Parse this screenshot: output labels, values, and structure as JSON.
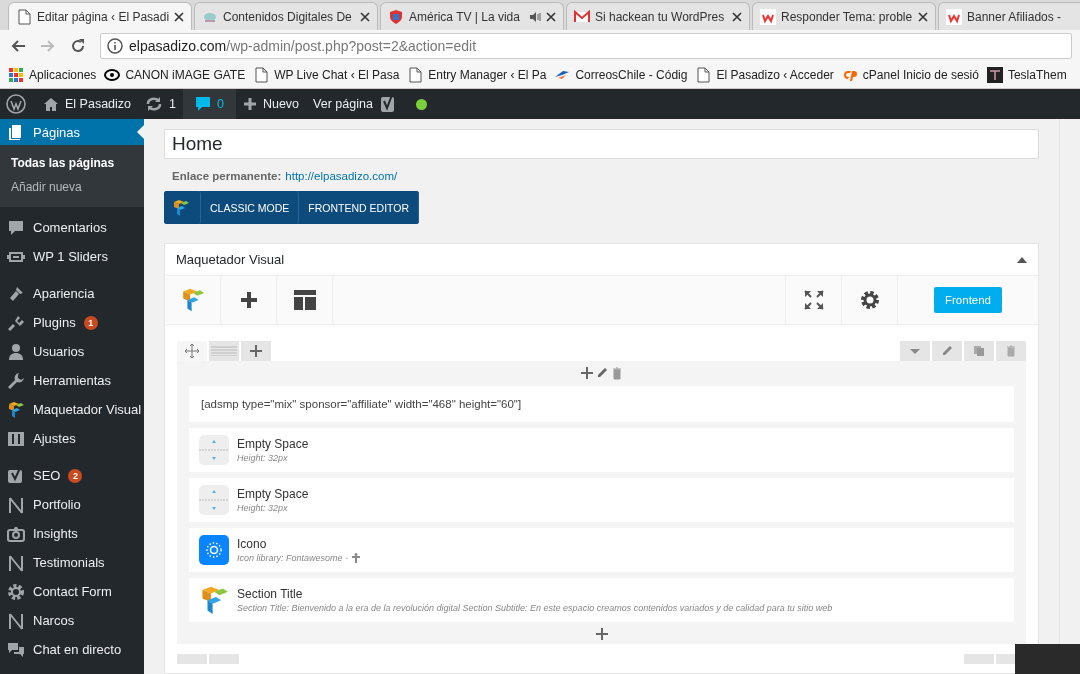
{
  "browser": {
    "tabs": [
      {
        "title": "Editar página ‹ El Pasadi",
        "selected": true
      },
      {
        "title": "Contenidos Digitales De",
        "selected": false
      },
      {
        "title": "América TV | La vida",
        "selected": false
      },
      {
        "title": "Si hackean tu WordPres",
        "selected": false
      },
      {
        "title": "Responder Tema: proble",
        "selected": false
      },
      {
        "title": "Banner Afiliados -",
        "selected": false
      }
    ],
    "url": {
      "host": "elpasadizo.com",
      "path": "/wp-admin/post.php?post=2&action=edit"
    },
    "bookmarks": [
      "Aplicaciones",
      "CANON iMAGE GATE",
      "WP Live Chat ‹ El Pasa",
      "Entry Manager ‹ El Pa",
      "CorreosChile - Códig",
      "El Pasadizo ‹ Acceder",
      "cPanel Inicio de sesió",
      "TeslaThem"
    ]
  },
  "admin_bar": {
    "site": "El Pasadizo",
    "updates": "1",
    "comments": "0",
    "new": "Nuevo",
    "view": "Ver página"
  },
  "sidebar": {
    "groups": [
      [
        {
          "label": "Páginas",
          "selected": true,
          "children": [
            {
              "label": "Todas las páginas",
              "selected": true
            },
            {
              "label": "Añadir nueva",
              "selected": false
            }
          ]
        },
        {
          "label": "Comentarios",
          "selected": false
        },
        {
          "label": "WP 1 Sliders",
          "selected": false
        }
      ],
      [
        {
          "label": "Apariencia",
          "selected": false
        },
        {
          "label": "Plugins",
          "selected": false,
          "badge": "1"
        },
        {
          "label": "Usuarios",
          "selected": false
        },
        {
          "label": "Herramientas",
          "selected": false
        },
        {
          "label": "Maquetador Visual",
          "selected": false
        },
        {
          "label": "Ajustes",
          "selected": false
        }
      ],
      [
        {
          "label": "SEO",
          "selected": false,
          "badge": "2"
        },
        {
          "label": "Portfolio",
          "selected": false
        },
        {
          "label": "Insights",
          "selected": false
        },
        {
          "label": "Testimonials",
          "selected": false
        },
        {
          "label": "Contact Form",
          "selected": false
        },
        {
          "label": "Narcos",
          "selected": false
        },
        {
          "label": "Chat en directo",
          "selected": false
        }
      ]
    ]
  },
  "editor": {
    "title": "Home",
    "permalink_label": "Enlace permanente:",
    "permalink": "http://elpasadizo.com/",
    "mode_buttons": [
      "CLASSIC MODE",
      "FRONTEND EDITOR"
    ],
    "builder": {
      "title": "Maquetador Visual",
      "frontend_button": "Frontend",
      "elements": [
        {
          "kind": "text",
          "text": "[adsmp type=\"mix\" sponsor=\"affiliate\" width=\"468\" height=\"60\"]"
        },
        {
          "kind": "empty-space",
          "title": "Empty Space",
          "detail": "Height: 32px"
        },
        {
          "kind": "empty-space",
          "title": "Empty Space",
          "detail": "Height: 32px"
        },
        {
          "kind": "icon",
          "title": "Icono",
          "detail": "Icon library: Fontawesome -"
        },
        {
          "kind": "section-title",
          "title": "Section Title",
          "detail": "Section Title: Bienvenido a la era de la revolución digital  Section Subtitle: En este espacio creamos contenidos variados y de calidad para tu sitio web"
        }
      ]
    }
  }
}
